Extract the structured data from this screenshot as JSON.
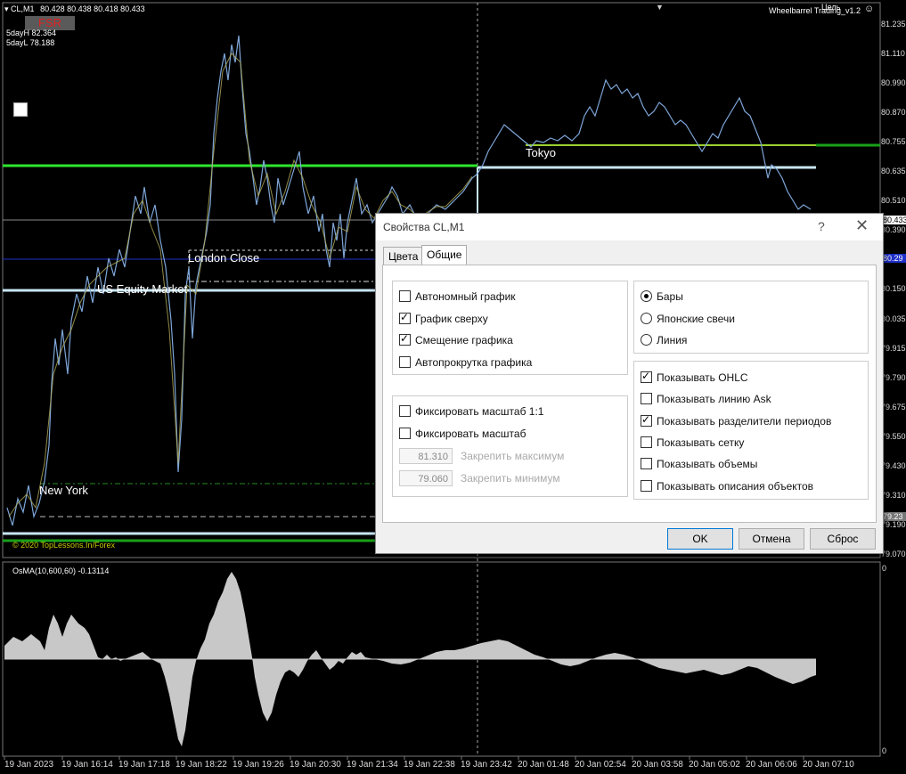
{
  "header": {
    "symbol_label": "CL,M1",
    "ohlc": "80.428 80.438 80.418 80.433",
    "fsr_badge": "FSR",
    "five_day_high": "5dayH 82.364",
    "five_day_low": "5dayL 78.188",
    "ea_name": "Wheelbarrel Trading_v1.2",
    "ea_tag": "Цель"
  },
  "session_labels": {
    "tokyo": "Tokyo",
    "london_close": "London Close",
    "us_equity": "US Equity Market",
    "new_york": "New York"
  },
  "copyright": "© 2020 TopLessons.In/Forex",
  "indicator": {
    "label": "OsMA(10,600,60) -0.13114",
    "scale_top": "0",
    "scale_bottom": "0"
  },
  "price_axis": {
    "labels": [
      "81.235",
      "81.110",
      "80.990",
      "80.870",
      "80.755",
      "80.635",
      "80.510",
      "80.390",
      "80.270",
      "80.150",
      "80.035",
      "79.915",
      "79.790",
      "79.675",
      "79.550",
      "79.430",
      "79.310",
      "79.190",
      "79.070"
    ],
    "current_price": "80.433",
    "blue_line_tag": "80.29",
    "green_line_tag": "79.23"
  },
  "time_axis": [
    "19 Jan 2023",
    "19 Jan 16:14",
    "19 Jan 17:18",
    "19 Jan 18:22",
    "19 Jan 19:26",
    "19 Jan 20:30",
    "19 Jan 21:34",
    "19 Jan 22:38",
    "19 Jan 23:42",
    "20 Jan 01:48",
    "20 Jan 02:54",
    "20 Jan 03:58",
    "20 Jan 05:02",
    "20 Jan 06:06",
    "20 Jan 07:10"
  ],
  "dialog": {
    "title": "Свойства CL,M1",
    "help": "?",
    "close": "✕",
    "tabs": [
      "Цвета",
      "Общие"
    ],
    "active_tab": "Общие",
    "group_chart": [
      {
        "label": "Автономный график",
        "checked": false
      },
      {
        "label": "График сверху",
        "checked": true
      },
      {
        "label": "Смещение графика",
        "checked": true
      },
      {
        "label": "Автопрокрутка графика",
        "checked": false
      }
    ],
    "group_scale": {
      "fix_1_1": {
        "label": "Фиксировать масштаб 1:1",
        "checked": false
      },
      "fix_scale": {
        "label": "Фиксировать масштаб",
        "checked": false
      },
      "max_value": "81.310",
      "max_label": "Закрепить максимум",
      "min_value": "79.060",
      "min_label": "Закрепить минимум"
    },
    "group_type": [
      {
        "label": "Бары",
        "checked": true
      },
      {
        "label": "Японские свечи",
        "checked": false
      },
      {
        "label": "Линия",
        "checked": false
      }
    ],
    "group_show": [
      {
        "label": "Показывать OHLC",
        "checked": true
      },
      {
        "label": "Показывать линию Ask",
        "checked": false
      },
      {
        "label": "Показывать разделители периодов",
        "checked": true
      },
      {
        "label": "Показывать сетку",
        "checked": false
      },
      {
        "label": "Показывать объемы",
        "checked": false
      },
      {
        "label": "Показывать описания объектов",
        "checked": false
      }
    ],
    "buttons": {
      "ok": "OK",
      "cancel": "Отмена",
      "reset": "Сброс"
    }
  },
  "colors": {
    "background": "#000000",
    "price_line": "#7ea6d8",
    "price_line_alt": "#b5ae5a",
    "green_level": "#2ee62e",
    "lightblue_level": "#c8e6f5",
    "osma": "#c8c8c8",
    "arrow": "#e00000"
  }
}
